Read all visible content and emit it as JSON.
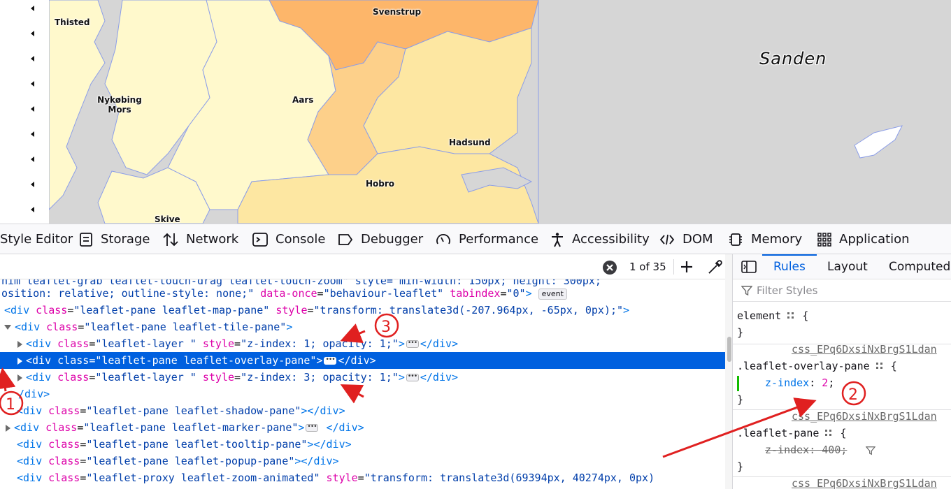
{
  "map": {
    "cities": [
      "Thisted",
      "Svenstrup",
      "Nykøbing",
      "Mors",
      "Aars",
      "Hadsund",
      "Hobro",
      "Skive"
    ],
    "sea_label": "Sanden",
    "colors": {
      "water": "#d6d6d6",
      "region_light": "#fff9cc",
      "region_mid": "#fde7a2",
      "region_dark": "#fdb66a",
      "border": "#8c9ee8"
    }
  },
  "devtools": {
    "tabs": [
      "Style Editor",
      "Storage",
      "Network",
      "Console",
      "Debugger",
      "Performance",
      "Accessibility",
      "DOM",
      "Memory",
      "Application"
    ],
    "search": {
      "count": "1 of 35"
    },
    "markup": {
      "l0": "nim leaflet-grab leaflet-touch-drag leaflet-touch-zoom\" style=\"min-width: 150px; height: 300px;",
      "l1a": "osition: relative; outline-style: none;\" ",
      "l1attr1": "data-once",
      "l1val1": "\"behaviour-leaflet\"",
      "l1attr2": "tabindex",
      "l1val2": "\"0\"",
      "l1badge": "event",
      "map_pane_cls": "\"leaflet-pane leaflet-map-pane\"",
      "map_pane_style": "\"transform: translate3d(-207.964px, -65px, 0px);\"",
      "tile_pane_cls": "\"leaflet-pane leaflet-tile-pane\"",
      "layer1_cls": "\"leaflet-layer \"",
      "layer1_style": "\"z-index: 1; opacity: 1;\"",
      "overlay_cls": "\"leaflet-pane leaflet-overlay-pane\"",
      "layer3_cls": "\"leaflet-layer \"",
      "layer3_style": "\"z-index: 3; opacity: 1;\"",
      "close_div": "/div>",
      "shadow_cls": "\"leaflet-pane leaflet-shadow-pane\"",
      "marker_cls": "\"leaflet-pane leaflet-marker-pane\"",
      "tooltip_cls": "\"leaflet-pane leaflet-tooltip-pane\"",
      "popup_cls": "\"leaflet-pane leaflet-popup-pane\"",
      "proxy_cls": "\"leaflet-proxy leaflet-zoom-animated\"",
      "proxy_style": "\"transform: translate3d(69394px, 40274px, 0px)"
    },
    "sidebar": {
      "tabs": [
        "Rules",
        "Layout",
        "Computed"
      ],
      "filter_placeholder": "Filter Styles",
      "element_selector": "element",
      "source": "css_EPq6DxsiNxBrgS1Ldan",
      "rule1_selector": ".leaflet-overlay-pane",
      "rule1_prop": "z-index",
      "rule1_val": "2",
      "rule2_selector": ".leaflet-pane",
      "rule2_prop": "z-index",
      "rule2_val": "400"
    }
  },
  "annotations": [
    "1",
    "2",
    "3"
  ]
}
